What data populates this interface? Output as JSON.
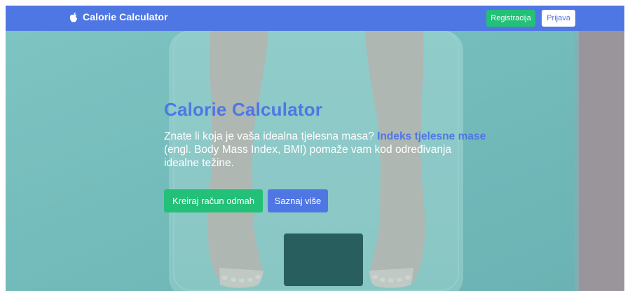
{
  "navbar": {
    "brand_icon": "apple-icon",
    "brand": "Calorie Calculator",
    "register_label": "Registracija",
    "login_label": "Prijava"
  },
  "hero": {
    "title": "Calorie Calculator",
    "text_before": "Znate li koja je vaša idealna tjelesna masa? ",
    "text_highlight": "Indeks tjelesne mase",
    "text_after": " (engl. Body Mass Index, BMI) pomaže vam kod određivanja idealne težine.",
    "primary_button": "Kreiraj račun odmah",
    "secondary_button": "Saznaj više"
  },
  "colors": {
    "nav_bg": "#4f77e3",
    "accent": "#4f77e3",
    "success": "#23c078",
    "hero_tint": "#7bbcbc"
  }
}
